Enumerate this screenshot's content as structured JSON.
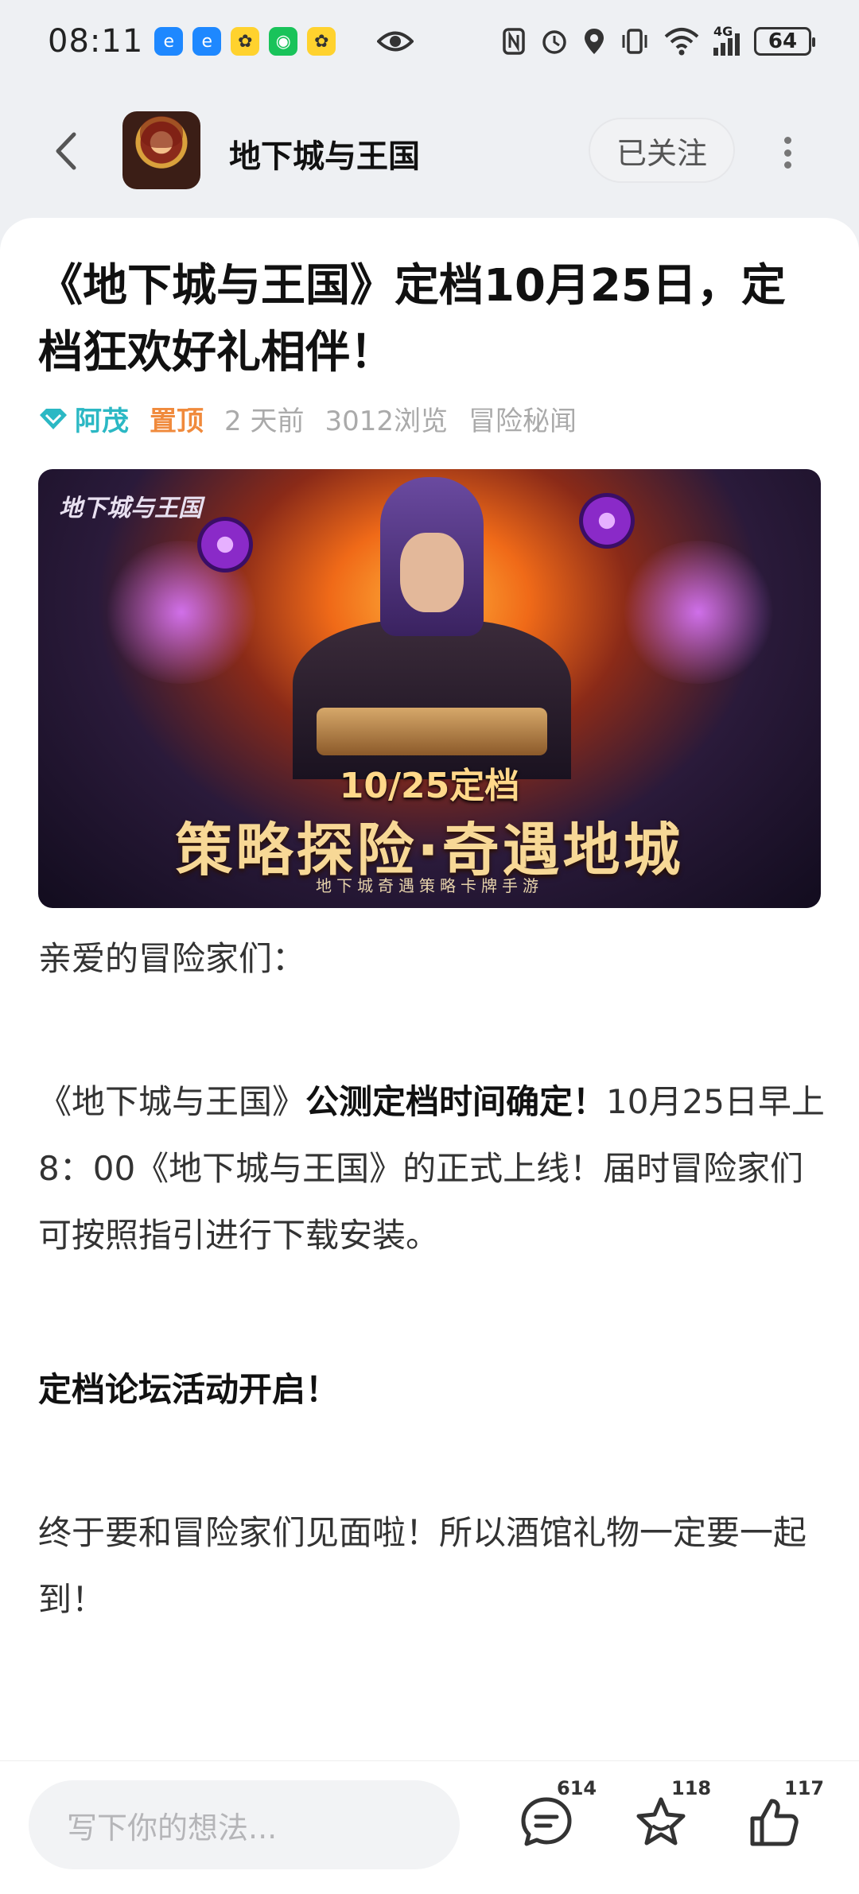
{
  "status_bar": {
    "time": "08:11",
    "battery": "64",
    "network": "4G"
  },
  "header": {
    "game_name": "地下城与王国",
    "follow_label": "已关注"
  },
  "post": {
    "title": "《地下城与王国》定档10月25日，定档狂欢好礼相伴！",
    "author": "阿茂",
    "pinned_label": "置顶",
    "time_ago": "2 天前",
    "views": "3012浏览",
    "category": "冒险秘闻",
    "banner": {
      "logo_text": "地下城与王国",
      "date_text": "10/25定档",
      "main_text": "策略探险·奇遇地城",
      "sub_text": "地下城奇遇策略卡牌手游"
    },
    "paragraph_1": "亲爱的冒险家们：",
    "paragraph_2_prefix": "《地下城与王国》",
    "paragraph_2_bold": "公测定档时间确定！",
    "paragraph_2_rest": "10月25日早上 8：00《地下城与王国》的正式上线！届时冒险家们可按照指引进行下载安装。",
    "paragraph_3": "定档论坛活动开启！",
    "paragraph_4": "终于要和冒险家们见面啦！所以酒馆礼物一定要一起到！"
  },
  "bottom_bar": {
    "comment_placeholder": "写下你的想法...",
    "comment_count": "614",
    "favorite_count": "118",
    "like_count": "117"
  }
}
